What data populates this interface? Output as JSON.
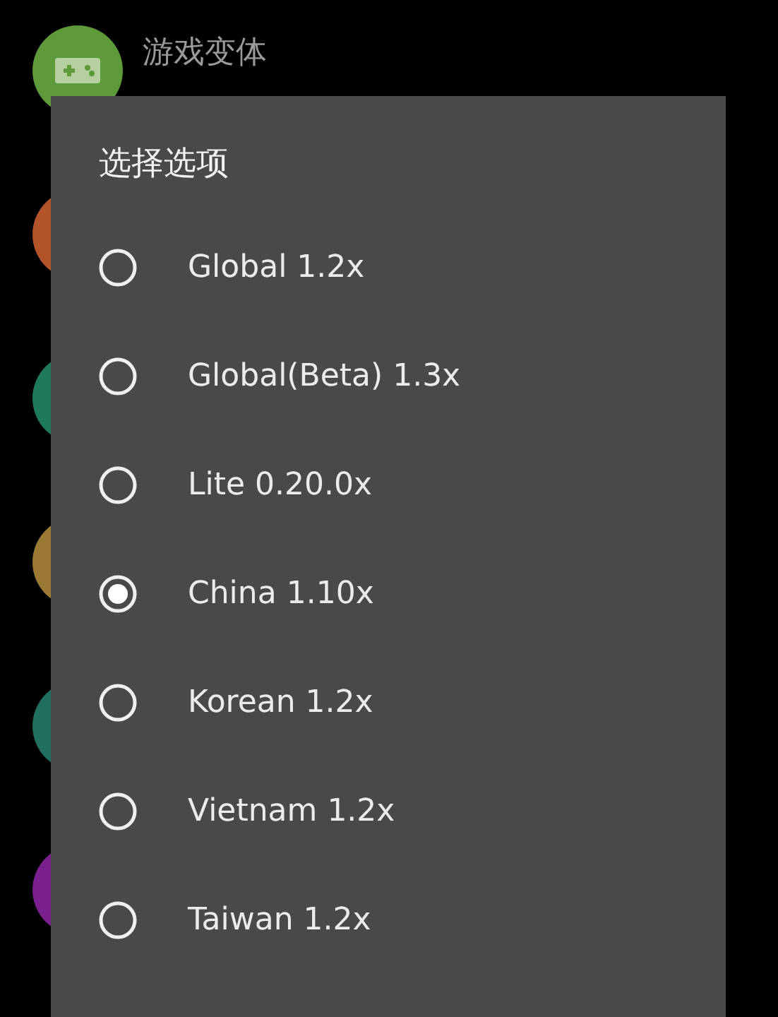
{
  "background_list": {
    "items": [
      {
        "kind": "game",
        "title": "游戏变体",
        "color": "#5f9a3a"
      },
      {
        "kind": "plain",
        "color": "#b3532a"
      },
      {
        "kind": "plain",
        "color": "#1f7a5c"
      },
      {
        "kind": "plain",
        "color": "#9a7a35"
      },
      {
        "kind": "plain",
        "color": "#1f6e5e"
      },
      {
        "kind": "plain",
        "color": "#7a1f8e"
      }
    ]
  },
  "dialog": {
    "title": "选择选项",
    "options": [
      {
        "label": "Global 1.2x",
        "selected": false
      },
      {
        "label": "Global(Beta) 1.3x",
        "selected": false
      },
      {
        "label": "Lite 0.20.0x",
        "selected": false
      },
      {
        "label": "China 1.10x",
        "selected": true
      },
      {
        "label": "Korean 1.2x",
        "selected": false
      },
      {
        "label": "Vietnam 1.2x",
        "selected": false
      },
      {
        "label": "Taiwan 1.2x",
        "selected": false
      }
    ]
  }
}
